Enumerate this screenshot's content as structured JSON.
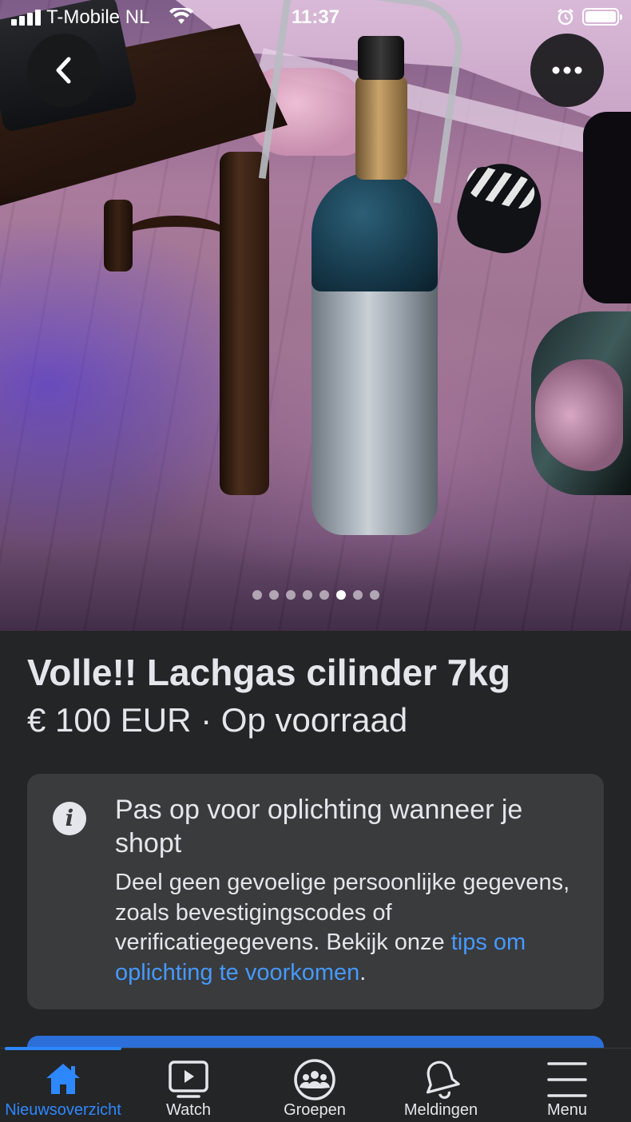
{
  "status_bar": {
    "carrier": "T-Mobile NL",
    "time": "11:37"
  },
  "photo": {
    "dots_total": 8,
    "dots_active_index": 5
  },
  "listing": {
    "title": "Volle!! Lachgas cilinder 7kg",
    "price_line": "€ 100 EUR · Op voorraad"
  },
  "notice": {
    "icon": "info-icon",
    "title": "Pas op voor oplichting wanneer je shopt",
    "body": "Deel geen gevoelige persoonlijke gegevens, zoals bevestigingscodes of verificatiegegevens. Bekijk onze ",
    "link": "tips om oplichting te voorkomen",
    "end": "."
  },
  "tabs": [
    {
      "label": "Nieuwsoverzicht",
      "icon": "home-icon",
      "active": true
    },
    {
      "label": "Watch",
      "icon": "watch-play-icon",
      "active": false
    },
    {
      "label": "Groepen",
      "icon": "groups-icon",
      "active": false
    },
    {
      "label": "Meldingen",
      "icon": "bell-icon",
      "active": false
    },
    {
      "label": "Menu",
      "icon": "menu-icon",
      "active": false
    }
  ],
  "colors": {
    "background": "#242526",
    "card": "#3a3b3c",
    "accent": "#2d88ff",
    "link": "#4599ff",
    "text": "#e4e6eb"
  }
}
